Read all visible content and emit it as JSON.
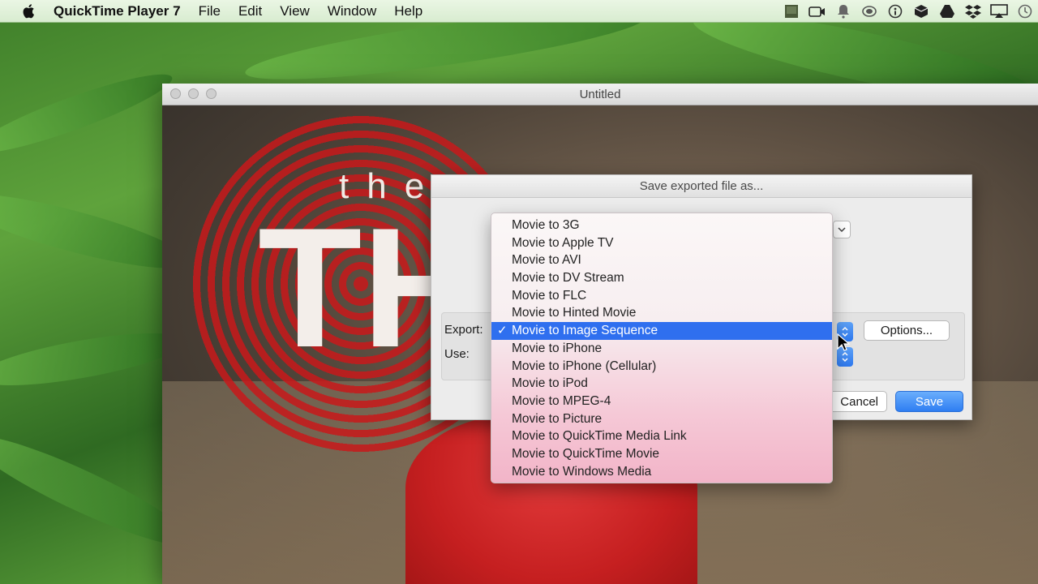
{
  "menubar": {
    "app_name": "QuickTime Player 7",
    "menus": [
      "File",
      "Edit",
      "View",
      "Window",
      "Help"
    ],
    "status_icons": [
      "screen-icon",
      "camera-icon",
      "notification-bell-icon",
      "sync-icon",
      "info-icon",
      "box-icon",
      "drive-icon",
      "dropbox-icon",
      "airplay-icon",
      "time-machine-icon"
    ]
  },
  "player": {
    "title": "Untitled",
    "video_text_small": "the",
    "video_text_large": "TH"
  },
  "dialog": {
    "title": "Save exported file as...",
    "export_label": "Export:",
    "use_label": "Use:",
    "options_button": "Options...",
    "cancel_button": "Cancel",
    "save_button": "Save"
  },
  "export_menu": {
    "items": [
      "Movie to 3G",
      "Movie to Apple TV",
      "Movie to AVI",
      "Movie to DV Stream",
      "Movie to FLC",
      "Movie to Hinted Movie",
      "Movie to Image Sequence",
      "Movie to iPhone",
      "Movie to iPhone (Cellular)",
      "Movie to iPod",
      "Movie to MPEG-4",
      "Movie to Picture",
      "Movie to QuickTime Media Link",
      "Movie to QuickTime Movie",
      "Movie to Windows Media"
    ],
    "selected": "Movie to Image Sequence",
    "check": "✓"
  },
  "colors": {
    "selection": "#2f6fef",
    "save_button": "#2f7ef2"
  }
}
